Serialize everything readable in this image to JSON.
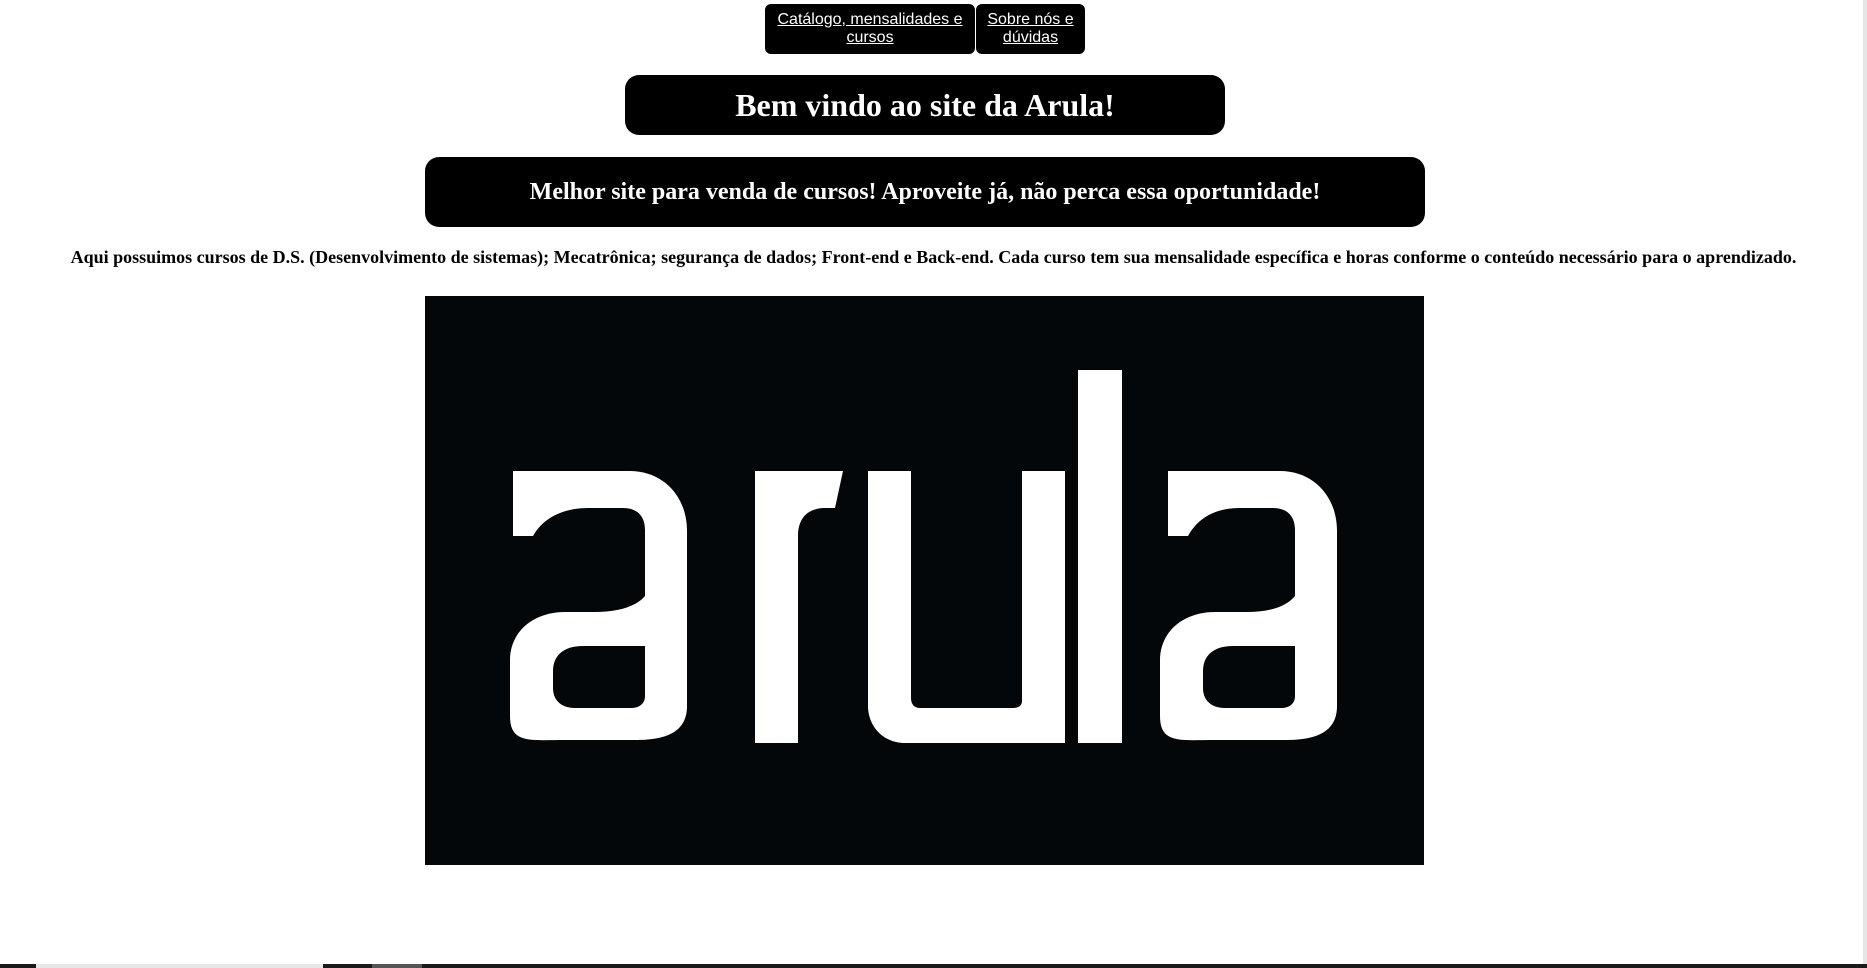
{
  "nav": {
    "catalog_link": "Catálogo, mensalidades e cursos",
    "about_link": "Sobre nós e dúvidas"
  },
  "welcome_title": "Bem vindo ao site da Arula!",
  "promo_text": "Melhor site para venda de cursos! Aproveite já, não perca essa oportunidade!",
  "description": "Aqui possuimos cursos de D.S. (Desenvolvimento de sistemas); Mecatrônica; segurança de dados; Front-end e Back-end. Cada curso tem sua mensalidade específica e horas conforme o conteúdo necessário para o aprendizado.",
  "logo": {
    "text": "arula",
    "background": "#03070a",
    "foreground": "#ffffff"
  },
  "colors": {
    "button_bg": "#000000",
    "button_text": "#ffffff",
    "page_bg": "#ffffff"
  }
}
